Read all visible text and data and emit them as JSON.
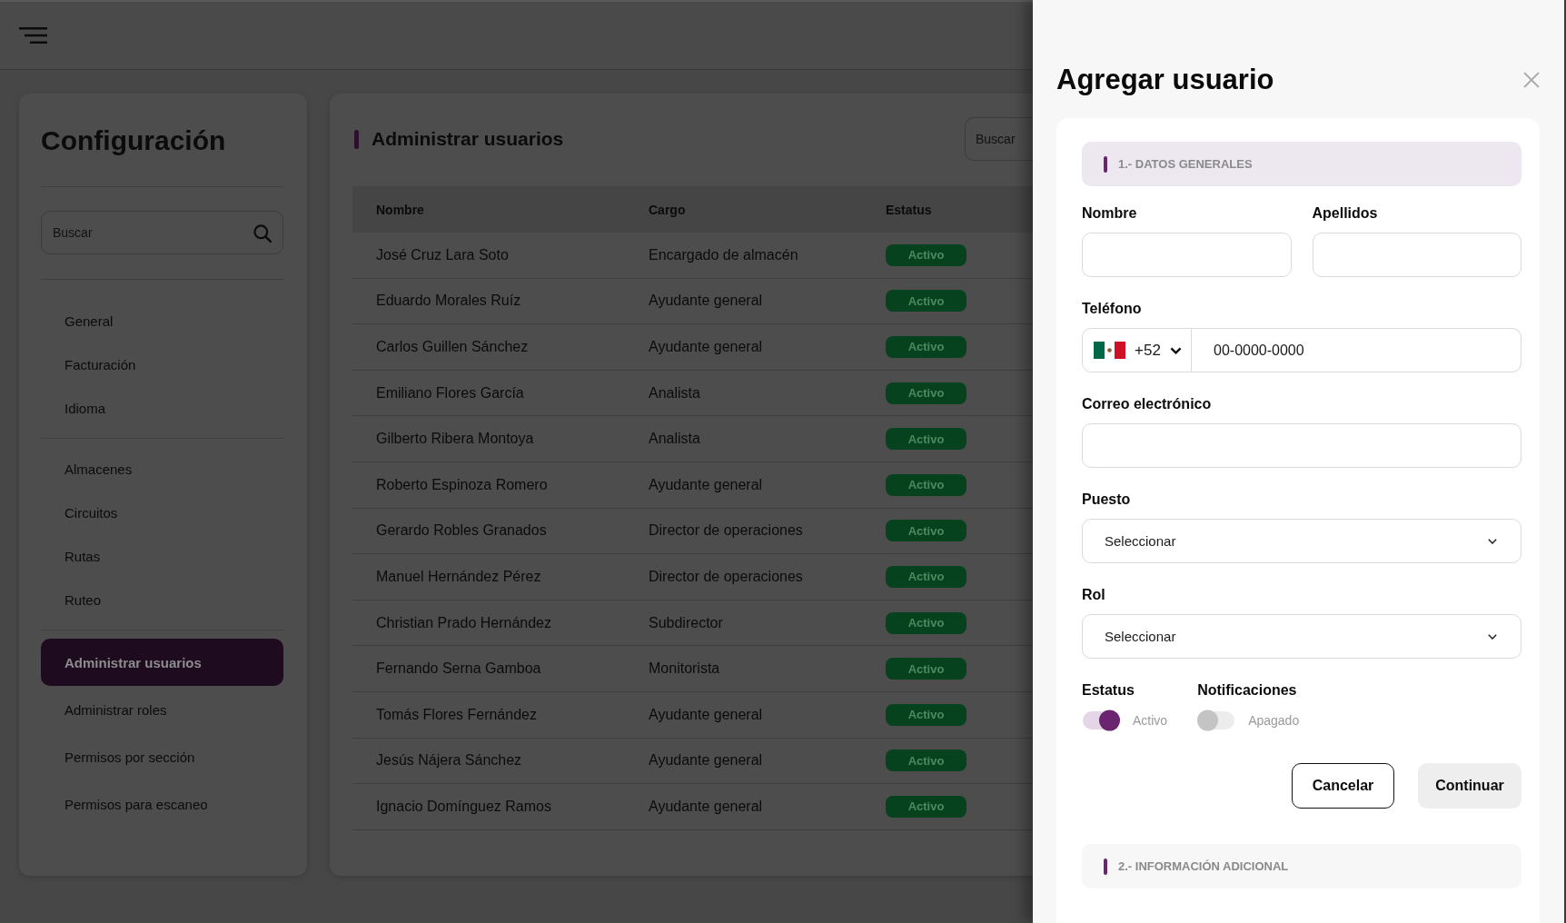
{
  "sidebar": {
    "title": "Configuración",
    "search": {
      "placeholder": "Buscar"
    },
    "groups": [
      {
        "items": [
          {
            "label": "General",
            "selected": false
          },
          {
            "label": "Facturación",
            "selected": false
          },
          {
            "label": "Idioma",
            "selected": false
          }
        ]
      },
      {
        "items": [
          {
            "label": "Almacenes",
            "selected": false
          },
          {
            "label": "Circuitos",
            "selected": false
          },
          {
            "label": "Rutas",
            "selected": false
          },
          {
            "label": "Ruteo",
            "selected": false
          }
        ]
      },
      {
        "items": [
          {
            "label": "Administrar usuarios",
            "selected": true
          },
          {
            "label": "Administrar roles",
            "selected": false
          },
          {
            "label": "Permisos por sección",
            "selected": false
          },
          {
            "label": "Permisos para escaneo",
            "selected": false
          }
        ]
      }
    ]
  },
  "users": {
    "title": "Administrar usuarios",
    "search": {
      "placeholder": "Buscar"
    },
    "table": {
      "columns": [
        "Nombre",
        "Cargo",
        "Estatus"
      ],
      "rows": [
        {
          "name": "José Cruz Lara Soto",
          "position": "Encargado de almacén",
          "status": "Activo"
        },
        {
          "name": "Eduardo Morales Ruíz",
          "position": "Ayudante general",
          "status": "Activo"
        },
        {
          "name": "Carlos Guillen Sánchez",
          "position": "Ayudante general",
          "status": "Activo"
        },
        {
          "name": "Emiliano Flores García",
          "position": "Analista",
          "status": "Activo"
        },
        {
          "name": "Gilberto Ribera Montoya",
          "position": "Analista",
          "status": "Activo"
        },
        {
          "name": "Roberto Espinoza Romero",
          "position": "Ayudante general",
          "status": "Activo"
        },
        {
          "name": "Gerardo Robles Granados",
          "position": "Director de operaciones",
          "status": "Activo"
        },
        {
          "name": "Manuel Hernández Pérez",
          "position": "Director de operaciones",
          "status": "Activo"
        },
        {
          "name": "Christian Prado Hernández",
          "position": "Subdirector",
          "status": "Activo"
        },
        {
          "name": "Fernando Serna Gamboa",
          "position": "Monitorista",
          "status": "Activo"
        },
        {
          "name": "Tomás Flores Fernández",
          "position": "Ayudante general",
          "status": "Activo"
        },
        {
          "name": "Jesús Nájera Sánchez",
          "position": "Ayudante general",
          "status": "Activo"
        },
        {
          "name": "Ignacio Domínguez Ramos",
          "position": "Ayudante general",
          "status": "Activo"
        }
      ]
    }
  },
  "drawer": {
    "title": "Agregar usuario",
    "sections": [
      {
        "title": "1.- DATOS GENERALES",
        "expanded": true,
        "rows": [
          {
            "fields": [
              {
                "kind": "text",
                "label": "Nombre"
              },
              {
                "kind": "text",
                "label": "Apellidos"
              }
            ]
          },
          {
            "fields": [
              {
                "kind": "phone",
                "label": "Teléfono",
                "country_code": "+52",
                "placeholder": "00-0000-0000"
              }
            ]
          },
          {
            "fields": [
              {
                "kind": "text",
                "label": "Correo electrónico"
              }
            ]
          },
          {
            "fields": [
              {
                "kind": "select",
                "label": "Puesto",
                "placeholder": "Seleccionar"
              }
            ]
          },
          {
            "fields": [
              {
                "kind": "select",
                "label": "Rol",
                "placeholder": "Seleccionar"
              }
            ]
          },
          {
            "fields": [
              {
                "kind": "toggle",
                "label": "Estatus",
                "on": true,
                "state_label": "Activo"
              },
              {
                "kind": "toggle",
                "label": "Notificaciones",
                "on": false,
                "state_label": "Apagado"
              }
            ]
          }
        ],
        "buttons": [
          {
            "label": "Cancelar",
            "kind": "outline"
          },
          {
            "label": "Continuar",
            "kind": "filled"
          }
        ]
      },
      {
        "title": "2.- INFORMACIÓN ADICIONAL",
        "expanded": false
      }
    ]
  }
}
